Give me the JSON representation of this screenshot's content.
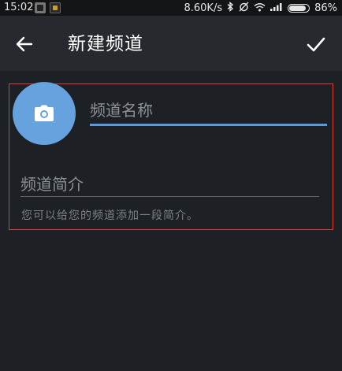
{
  "status_bar": {
    "time": "15:02",
    "network_speed": "8.60K/s",
    "battery_percent": "86%",
    "battery_level": 0.86,
    "icons": [
      "bluetooth-icon",
      "alarm-off-icon",
      "wifi-icon",
      "signal-icon",
      "battery-icon"
    ]
  },
  "app_bar": {
    "title": "新建频道",
    "back_icon": "arrow-left-icon",
    "done_icon": "check-icon"
  },
  "form": {
    "avatar_icon": "camera-icon",
    "name_placeholder": "频道名称",
    "about_placeholder": "频道简介",
    "helper_text": "您可以给您的频道添加一段简介。"
  },
  "colors": {
    "background": "#1d2125",
    "app_bar": "#262a2f",
    "accent": "#5a9ad8",
    "avatar": "#65a2de",
    "highlight_border": "#e53935",
    "placeholder_text": "#8b9096"
  }
}
